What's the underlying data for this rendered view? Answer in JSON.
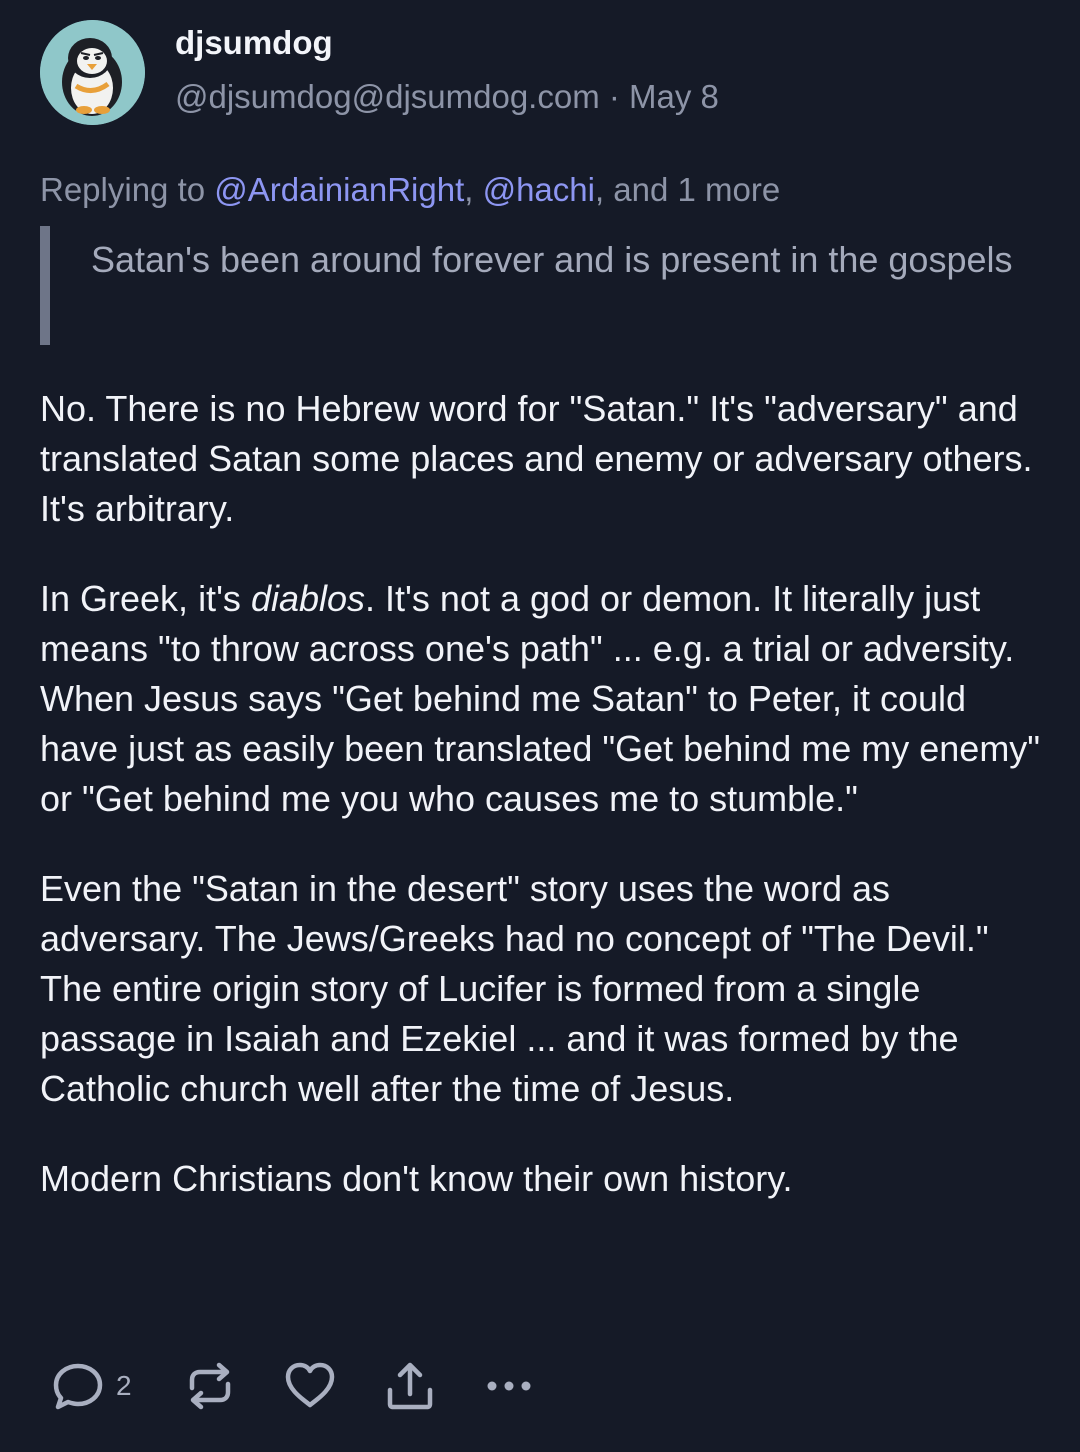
{
  "author": {
    "display_name": "djsumdog",
    "handle": "@djsumdog@djsumdog.com",
    "separator": " · ",
    "date": "May 8",
    "avatar_icon": "penguin-avatar-icon"
  },
  "reply_context": {
    "prefix": "Replying to ",
    "mentions": [
      "@ArdainianRight",
      "@hachi"
    ],
    "comma": ", ",
    "suffix": ", and 1 more"
  },
  "quote": {
    "text": "Satan's been around forever and is present in the gospels"
  },
  "body": {
    "p1": "No. There is no Hebrew word for \"Satan.\" It's \"adversary\" and translated Satan some places and enemy or adversary others. It's arbitrary.",
    "p2_before": "In Greek, it's ",
    "p2_italic": "diablos",
    "p2_after": ". It's not a god or demon. It literally just means \"to throw across one's path\" ... e.g. a trial or adversity. When Jesus says \"Get behind me Satan\" to Peter, it could have just as easily been translated \"Get behind me my enemy\" or \"Get behind me you who causes me to stumble.\"",
    "p3": "Even the \"Satan in the desert\" story uses the word as adversary. The Jews/Greeks had no concept of \"The Devil.\" The entire origin story of Lucifer is formed from a single passage in Isaiah and Ezekiel ... and it was formed by the Catholic church well after the time of Jesus.",
    "p4": "Modern Christians don't know their own history."
  },
  "actions": {
    "reply_count": "2",
    "icons": [
      "reply-icon",
      "repost-icon",
      "like-icon",
      "share-icon",
      "more-icon"
    ]
  },
  "colors": {
    "background": "#151a27",
    "text": "#f1f3f8",
    "muted": "#8d94a7",
    "mention": "#8d96f2",
    "quote_bar": "#6e7588",
    "icon": "#a9afc0"
  }
}
